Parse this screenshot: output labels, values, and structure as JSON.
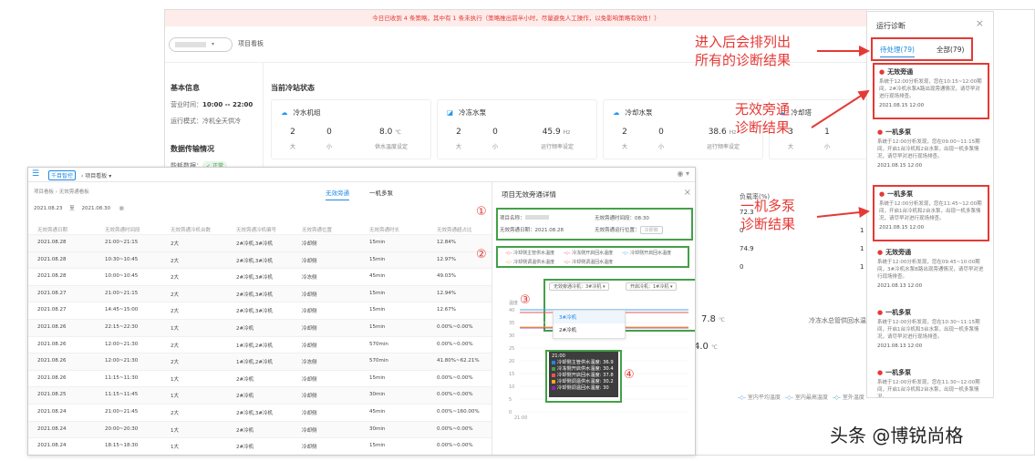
{
  "back": {
    "alert": "今日已收到 4 条策略，其中有 1 条未执行（策略推出前半小时，尽量避免人工操作，以免影响策略有效性！）",
    "project_select": "",
    "board_label": "项目看板",
    "basic_info": "基本信息",
    "hours_label": "营业时间：",
    "hours_value": "10:00 -- 22:00",
    "mode_label": "运行模式：",
    "mode_value": "冷机全天供冷",
    "data_sec": "数据传输情况",
    "energy_label": "能耗数据：",
    "energy_status": "正常",
    "station_title": "当前冷站状态",
    "cards": [
      {
        "name": "冷水机组",
        "icon": "☁",
        "n1": "2",
        "n2": "0",
        "val": "8.0",
        "unit": "℃",
        "l1": "大",
        "l2": "小",
        "lv": "供水温度设定"
      },
      {
        "name": "冷冻水泵",
        "icon": "◪",
        "n1": "2",
        "n2": "0",
        "val": "45.9",
        "unit": "Hz",
        "l1": "大",
        "l2": "小",
        "lv": "运行频率设定"
      },
      {
        "name": "冷却水泵",
        "icon": "☁",
        "n1": "2",
        "n2": "0",
        "val": "38.6",
        "unit": "Hz",
        "l1": "大",
        "l2": "小",
        "lv": "运行频率设定"
      },
      {
        "name": "冷却塔",
        "icon": "☁",
        "n1": "3",
        "n2": "1",
        "l1": "大",
        "l2": "小"
      }
    ],
    "load_rate_header": "负载率(%)",
    "load_rates": [
      "72.3",
      "0",
      "74.9",
      "0"
    ],
    "right_nums": [
      "1",
      "1",
      "1",
      "1"
    ],
    "temp1": "7.8",
    "temp2": "4.0",
    "temp_unit": "℃",
    "right_caption": "冷冻水总管供回水温度",
    "legend": [
      "室内平均温度",
      "室内最高温度",
      "室外温度"
    ]
  },
  "diagnosis": {
    "title": "运行诊断",
    "close": "×",
    "tab_pending": "待处理(79)",
    "tab_all": "全部(79)",
    "items": [
      {
        "title": "无效旁通",
        "text": "系统于12:00分析发现，您在10:15~12:00期间，2#冷机水泵A路出现旁通情况，请尽早对进行现场排查。",
        "time": "2021.08.15 12:00"
      },
      {
        "title": "一机多泵",
        "text": "系统于12:00分析发现，您在09:00~11:15期间，开启1台冷机和2台水泵，出现一机多泵情况，请尽早对进行现场排查。",
        "time": "2021.08.15 12:00"
      },
      {
        "title": "一机多泵",
        "text": "系统于12:00分析发现，您在11:45~12:00期间，开启1台冷机和2台水泵，出现一机多泵情况，请尽早对进行现场排查。",
        "time": "2021.08.15 12:00"
      },
      {
        "title": "无效旁通",
        "text": "系统于12:00分析发现，您在09:45~10:00期间，3#冷机水泵B路出现旁通情况，请尽早对进行现场排查。",
        "time": "2021.08.13 12:00"
      },
      {
        "title": "一机多泵",
        "text": "系统于12:00分析发现，您在10:30~11:15期间，开启1台冷机和3台水泵，出现一机多泵情况，请尽早对进行现场排查。",
        "time": "2021.08.13 12:00"
      },
      {
        "title": "一机多泵",
        "text": "系统于12:00分析发现，您在11:30~12:00期间，开启1台冷机和2台水泵，出现一机多泵情况。",
        "time": ""
      }
    ]
  },
  "annotations": {
    "a1": "进入后会排列出\n所有的诊断结果",
    "a2": "无效旁通\n诊断结果",
    "a3": "一机多泵\n诊断结果"
  },
  "front": {
    "menu_icon": "☰",
    "logo": "千目智控",
    "crumb": "› 项目看板 ▾",
    "user": "◉ ▾",
    "list_crumb": "项目看板 › 无效旁通看板",
    "tab_bypass": "无效旁通",
    "tab_multi": "一机多泵",
    "date_from": "2021.08.23",
    "date_sep": "至",
    "date_to": "2021.08.30",
    "headers": [
      "无效旁通日期",
      "无效旁通时间段",
      "无效旁通冷机台数",
      "无效旁通冷机编号",
      "无效旁通位置",
      "无效旁通时长",
      "无效旁通超占比"
    ],
    "rows": [
      [
        "2021.08.28",
        "21:00~21:15",
        "2大",
        "2#冷机,3#冷机",
        "冷却侧",
        "15min",
        "12.84%"
      ],
      [
        "2021.08.28",
        "10:30~10:45",
        "2大",
        "2#冷机,3#冷机",
        "冷却侧",
        "15min",
        "12.97%"
      ],
      [
        "2021.08.28",
        "10:00~10:45",
        "2大",
        "2#冷机,3#冷机",
        "冷冻侧",
        "45min",
        "49.03%"
      ],
      [
        "2021.08.27",
        "21:00~21:15",
        "2大",
        "2#冷机,3#冷机",
        "冷却侧",
        "15min",
        "12.94%"
      ],
      [
        "2021.08.27",
        "14:45~15:00",
        "2大",
        "2#冷机,3#冷机",
        "冷却侧",
        "15min",
        "12.67%"
      ],
      [
        "2021.08.26",
        "22:15~22:30",
        "1大",
        "2#冷机",
        "冷却侧",
        "15min",
        "0.00%~0.00%"
      ],
      [
        "2021.08.26",
        "12:00~21:30",
        "2大",
        "1#冷机,2#冷机",
        "冷却侧",
        "570min",
        "0.00%~0.00%"
      ],
      [
        "2021.08.26",
        "12:00~21:30",
        "2大",
        "1#冷机,2#冷机",
        "冷冻侧",
        "570min",
        "41.80%~62.21%"
      ],
      [
        "2021.08.26",
        "11:15~11:30",
        "1大",
        "2#冷机",
        "冷却侧",
        "15min",
        "0.00%~0.00%"
      ],
      [
        "2021.08.25",
        "11:15~11:45",
        "1大",
        "2#冷机",
        "冷却侧",
        "30min",
        "0.00%~0.00%"
      ],
      [
        "2021.08.24",
        "21:00~21:45",
        "2大",
        "2#冷机,3#冷机",
        "冷却侧",
        "45min",
        "0.00%~160.00%"
      ],
      [
        "2021.08.24",
        "20:00~20:30",
        "1大",
        "2#冷机",
        "冷却侧",
        "30min",
        "0.00%~0.00%"
      ],
      [
        "2021.08.24",
        "18:15~18:30",
        "1大",
        "2#冷机",
        "冷却侧",
        "15min",
        "0.00%~0.00%"
      ]
    ],
    "detail": {
      "title": "项目无效旁通详情",
      "close": "×",
      "project_label": "项目名称：",
      "time_seg": "无效旁通时间段：08:30",
      "date_label": "无效旁通日期：2021.08.28",
      "pos_label": "无效旁通运行位置：",
      "pos_value": "冷却侧",
      "legend": [
        "冷却侧主管供水温度",
        "冷冻侧开启回水温度",
        "冷却侧开启回水温度",
        "冷却侧调温供水温度",
        "冷却侧调温回水温度"
      ],
      "sel_a": "无效旁通冷机：3#冷机 ▾",
      "sel_b": "开启冷机：1#冷机 ▾",
      "dd": [
        "3#冷机",
        "2#冷机"
      ],
      "y_label": "温度",
      "y_ticks": [
        "40",
        "35",
        "30",
        "25",
        "20",
        "15",
        "10",
        "5",
        "0"
      ],
      "x_tick": "21:00",
      "tip_time": "21:00",
      "tip_rows": [
        "冷却侧主管供水温度: 36.9",
        "冷冻侧开启供水温度: 30.4",
        "冷却侧开启回水温度: 37.8",
        "冷却侧调温供水温度: 30.2",
        "冷却侧调温回水温度: 30"
      ],
      "tip_colors": [
        "#1e88e5",
        "#43a047",
        "#ef5350",
        "#ffa726",
        "#8e24aa"
      ],
      "circles": [
        "①",
        "②",
        "③",
        "④"
      ]
    }
  },
  "watermark": "头条 @博锐尚格"
}
